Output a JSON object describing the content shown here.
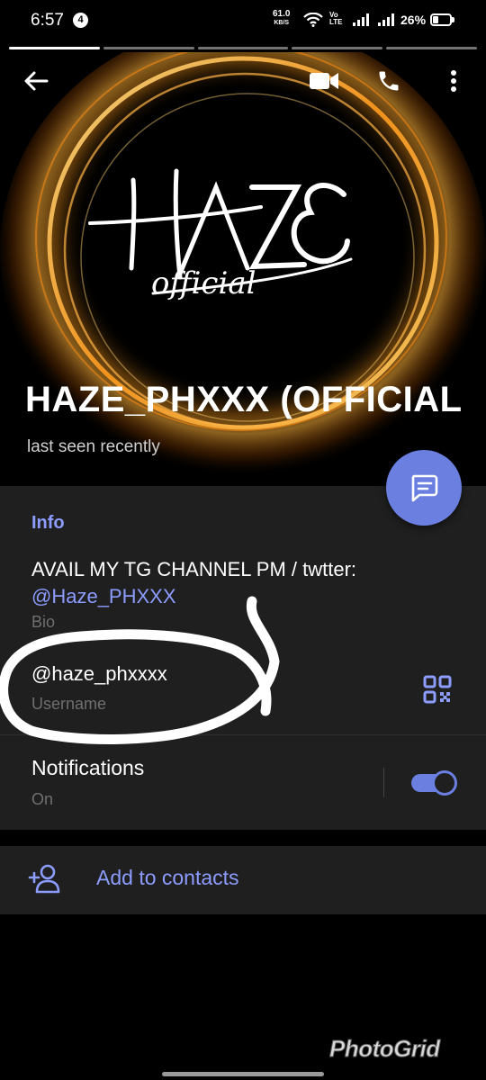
{
  "status_bar": {
    "time": "6:57",
    "notification_count": "4",
    "net_speed": "61.0",
    "net_speed_unit": "KB/S",
    "volte_line1": "Vo",
    "volte_line2": "LTE",
    "battery_text": "26%",
    "battery_level_percent": 26
  },
  "story_segments": 5,
  "profile": {
    "photo_logo_text": "HAZE",
    "photo_logo_subtext": "official",
    "name": "HAZE_PHXXX (OFFICIAL",
    "status": "last seen recently"
  },
  "info": {
    "section_title": "Info",
    "bio_text": "AVAIL MY TG CHANNEL PM / twtter:",
    "bio_link": "@Haze_PHXXX",
    "bio_label": "Bio",
    "username": "@haze_phxxxx",
    "username_label": "Username",
    "notifications_title": "Notifications",
    "notifications_status": "On",
    "notifications_enabled": true
  },
  "actions": {
    "add_to_contacts": "Add to contacts"
  },
  "watermark": "PhotoGrid",
  "colors": {
    "accent": "#8c9cff",
    "fab": "#6a7fe0",
    "card_bg": "#1f1f1f",
    "background": "#000000"
  },
  "icons": [
    "back-arrow-icon",
    "video-call-icon",
    "phone-icon",
    "more-vert-icon",
    "message-icon",
    "qr-code-icon",
    "add-person-icon",
    "wifi-icon",
    "signal-icon",
    "battery-icon"
  ]
}
